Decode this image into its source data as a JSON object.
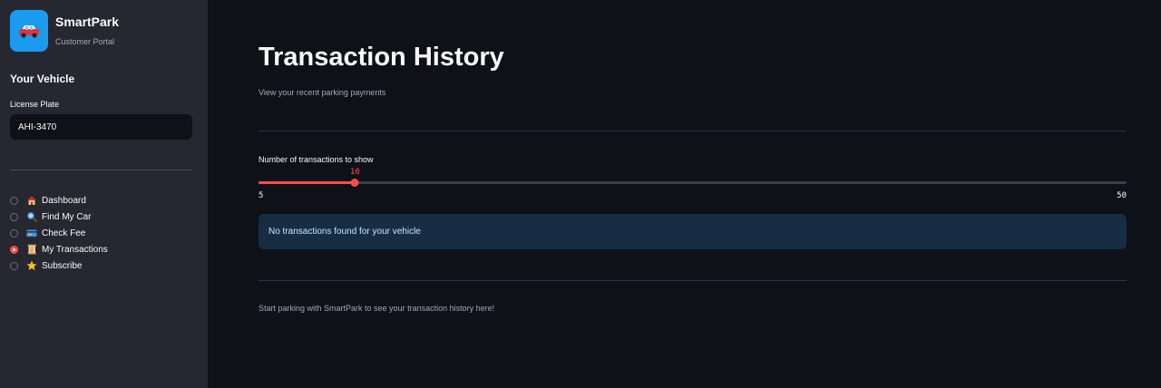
{
  "sidebar": {
    "app_name": "SmartPark",
    "app_subtitle": "Customer Portal",
    "logo_icon": "car-icon",
    "section_title": "Your Vehicle",
    "license_label": "License Plate",
    "license_value": "AHI-3470",
    "nav": [
      {
        "icon": "house-icon",
        "label": "Dashboard",
        "selected": false
      },
      {
        "icon": "magnifier-icon",
        "label": "Find My Car",
        "selected": false
      },
      {
        "icon": "credit-card-icon",
        "label": "Check Fee",
        "selected": false
      },
      {
        "icon": "scroll-icon",
        "label": "My Transactions",
        "selected": true
      },
      {
        "icon": "star-icon",
        "label": "Subscribe",
        "selected": false
      }
    ]
  },
  "main": {
    "title": "Transaction History",
    "subtitle": "View your recent parking payments",
    "slider": {
      "label": "Number of transactions to show",
      "value": 10,
      "value_text": "10",
      "min": 5,
      "min_text": "5",
      "max": 50,
      "max_text": "50"
    },
    "alert_text": "No transactions found for your vehicle",
    "footer_text": "Start parking with SmartPark to see your transaction history here!"
  },
  "colors": {
    "accent": "#ff4b4b",
    "sidebar_bg": "#262730",
    "main_bg": "#0e1117",
    "logo_bg": "#1a9bf0",
    "info_bg": "#172d43"
  }
}
